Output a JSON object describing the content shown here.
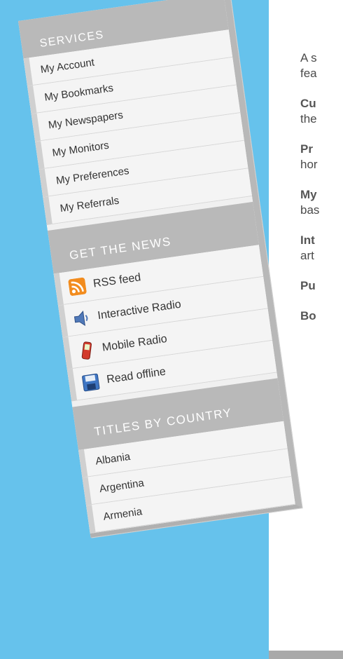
{
  "sidebar": {
    "services": {
      "header": "SERVICES",
      "items": [
        "My Account",
        "My Bookmarks",
        "My Newspapers",
        "My Monitors",
        "My Preferences",
        "My Referrals"
      ]
    },
    "news": {
      "header": "GET THE NEWS",
      "items": [
        {
          "label": "RSS feed",
          "icon": "rss-icon"
        },
        {
          "label": "Interactive Radio",
          "icon": "speaker-icon"
        },
        {
          "label": "Mobile Radio",
          "icon": "mobile-phone-icon"
        },
        {
          "label": "Read offline",
          "icon": "floppy-disk-icon"
        }
      ]
    },
    "countries": {
      "header": "TITLES BY COUNTRY",
      "items": [
        "Albania",
        "Argentina",
        "Armenia"
      ]
    }
  },
  "article": {
    "lines": [
      "A s",
      "fea",
      "Cu",
      "the",
      "Pr",
      "hor",
      "My",
      "bas",
      "Int",
      "art",
      "Pu",
      "Bo"
    ]
  },
  "colors": {
    "backdrop": "#66c2ec",
    "header": "#b9b9b9",
    "rss": "#f28c1e"
  }
}
